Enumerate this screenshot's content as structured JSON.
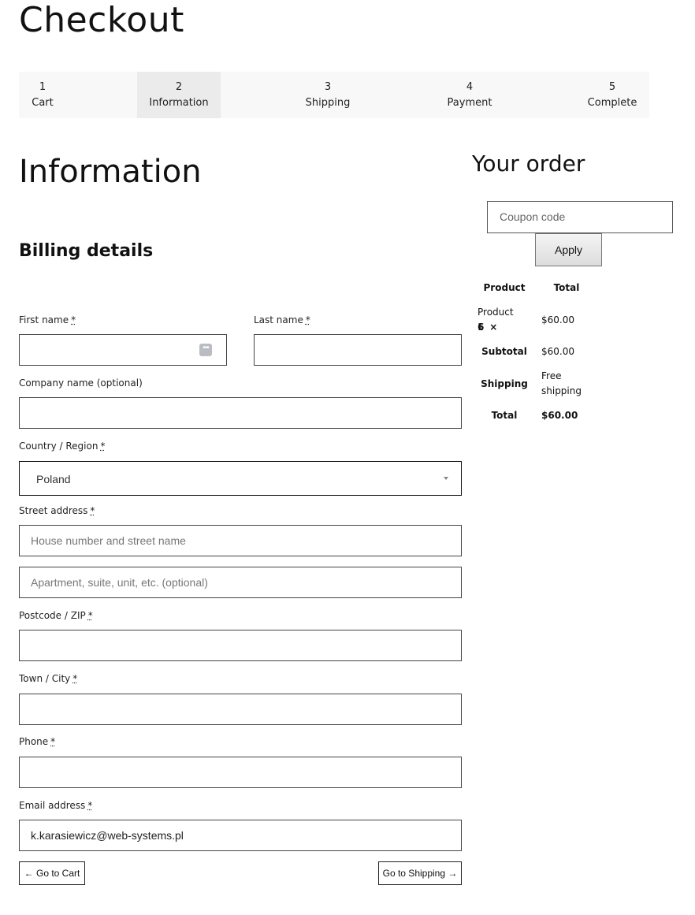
{
  "page": {
    "title": "Checkout"
  },
  "steps": [
    {
      "num": "1",
      "label": "Cart"
    },
    {
      "num": "2",
      "label": "Information"
    },
    {
      "num": "3",
      "label": "Shipping"
    },
    {
      "num": "4",
      "label": "Payment"
    },
    {
      "num": "5",
      "label": "Complete"
    }
  ],
  "active_step": 2,
  "section_title": "Information",
  "billing": {
    "title": "Billing details",
    "required_mark": "*",
    "first_name": {
      "label": "First name",
      "value": ""
    },
    "last_name": {
      "label": "Last name",
      "value": ""
    },
    "company": {
      "label": "Company name (optional)",
      "value": ""
    },
    "country": {
      "label": "Country / Region",
      "value": "Poland"
    },
    "street": {
      "label": "Street address",
      "placeholder1": "House number and street name",
      "placeholder2": "Apartment, suite, unit, etc. (optional)"
    },
    "postcode": {
      "label": "Postcode / ZIP",
      "value": ""
    },
    "town": {
      "label": "Town / City",
      "value": ""
    },
    "phone": {
      "label": "Phone",
      "value": ""
    },
    "email": {
      "label": "Email address",
      "value": "k.karasiewicz@web-systems.pl"
    },
    "autofill_icon": "key-dots-icon"
  },
  "nav": {
    "back_label": "← Go to Cart",
    "next_label": "Go to Shipping →"
  },
  "order": {
    "title": "Your order",
    "coupon_placeholder": "Coupon code",
    "apply_label": "Apply",
    "headers": {
      "product": "Product",
      "total": "Total"
    },
    "items": [
      {
        "name": "Product 1",
        "times": "×",
        "qty": "6",
        "total": "$60.00"
      }
    ],
    "subtotal": {
      "label": "Subtotal",
      "value": "$60.00"
    },
    "shipping": {
      "label": "Shipping",
      "value_line1": "Free",
      "value_line2": "shipping"
    },
    "total": {
      "label": "Total",
      "value": "$60.00"
    }
  }
}
